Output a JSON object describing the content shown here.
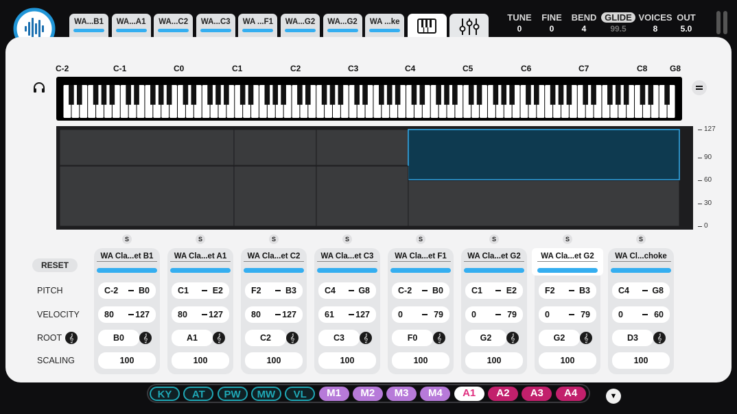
{
  "tabs": [
    "WA...B1",
    "WA...A1",
    "WA...C2",
    "WA...C3",
    "WA ...F1",
    "WA...G2",
    "WA...G2",
    "WA ...ke"
  ],
  "tab_icons": [
    "piano-icon",
    "sliders-icon"
  ],
  "params": [
    {
      "label": "TUNE",
      "value": "0"
    },
    {
      "label": "FINE",
      "value": "0"
    },
    {
      "label": "BEND",
      "value": "4"
    },
    {
      "label": "GLIDE",
      "value": "99.5"
    },
    {
      "label": "VOICES",
      "value": "8"
    },
    {
      "label": "OUT",
      "value": "5.0"
    }
  ],
  "octaves": [
    "C-2",
    "C-1",
    "C0",
    "C1",
    "C2",
    "C3",
    "C4",
    "C5",
    "C6",
    "C7",
    "C8",
    "G8"
  ],
  "velocity_ticks": [
    "127",
    "90",
    "60",
    "30",
    "0"
  ],
  "row_labels": {
    "reset": "RESET",
    "pitch": "PITCH",
    "velocity": "VELOCITY",
    "root": "ROOT",
    "scaling": "SCALING"
  },
  "solo_label": "S",
  "zones": [
    {
      "name": "WA Cla...et B1",
      "pitch_lo": "C-2",
      "pitch_hi": "B0",
      "vel_lo": "80",
      "vel_hi": "127",
      "root": "B0",
      "scaling": "100"
    },
    {
      "name": "WA Cla...et A1",
      "pitch_lo": "C1",
      "pitch_hi": "E2",
      "vel_lo": "80",
      "vel_hi": "127",
      "root": "A1",
      "scaling": "100"
    },
    {
      "name": "WA Cla...et C2",
      "pitch_lo": "F2",
      "pitch_hi": "B3",
      "vel_lo": "80",
      "vel_hi": "127",
      "root": "C2",
      "scaling": "100"
    },
    {
      "name": "WA Cla...et C3",
      "pitch_lo": "C4",
      "pitch_hi": "G8",
      "vel_lo": "61",
      "vel_hi": "127",
      "root": "C3",
      "scaling": "100"
    },
    {
      "name": "WA Cla...et F1",
      "pitch_lo": "C-2",
      "pitch_hi": "B0",
      "vel_lo": "0",
      "vel_hi": "79",
      "root": "F0",
      "scaling": "100"
    },
    {
      "name": "WA Cla...et G2",
      "pitch_lo": "C1",
      "pitch_hi": "E2",
      "vel_lo": "0",
      "vel_hi": "79",
      "root": "G2",
      "scaling": "100"
    },
    {
      "name": "WA Cla...et G2",
      "pitch_lo": "F2",
      "pitch_hi": "B3",
      "vel_lo": "0",
      "vel_hi": "79",
      "root": "G2",
      "scaling": "100"
    },
    {
      "name": "WA Cl...choke",
      "pitch_lo": "C4",
      "pitch_hi": "G8",
      "vel_lo": "0",
      "vel_hi": "60",
      "root": "D3",
      "scaling": "100"
    }
  ],
  "selected_zone": 6,
  "mod_buttons": [
    {
      "label": "KY",
      "style": "teal"
    },
    {
      "label": "AT",
      "style": "teal"
    },
    {
      "label": "PW",
      "style": "teal"
    },
    {
      "label": "MW",
      "style": "teal"
    },
    {
      "label": "VL",
      "style": "teal"
    },
    {
      "label": "M1",
      "style": "purple"
    },
    {
      "label": "M2",
      "style": "purple"
    },
    {
      "label": "M3",
      "style": "purple"
    },
    {
      "label": "M4",
      "style": "purple"
    },
    {
      "label": "A1",
      "style": "pinkA"
    },
    {
      "label": "A2",
      "style": "pink"
    },
    {
      "label": "A3",
      "style": "pink"
    },
    {
      "label": "A4",
      "style": "pink"
    }
  ],
  "colors": {
    "accent": "#34aef0",
    "zone_selected": "#0e3a50",
    "teal": "#1fa8b6",
    "purple": "#b77ad9",
    "pink": "#c2206c"
  }
}
